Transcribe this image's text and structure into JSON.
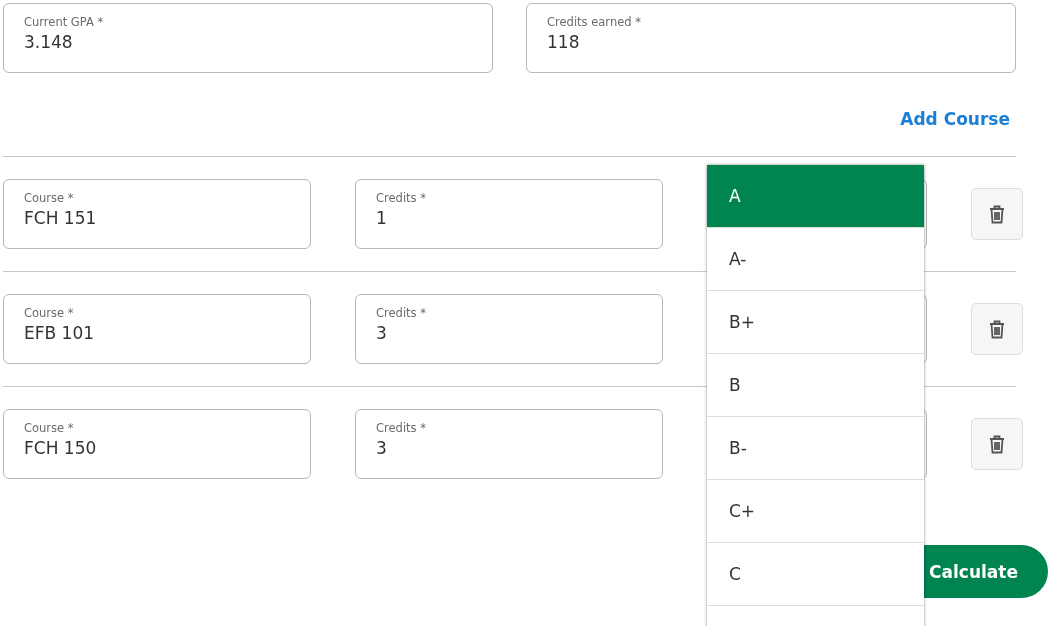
{
  "summary_fields": [
    {
      "label": "Current GPA *",
      "value": "3.148"
    },
    {
      "label": "Credits earned *",
      "value": "118"
    }
  ],
  "add_course": "Add Course",
  "courses": [
    {
      "course_label": "Course *",
      "course": "FCH 151",
      "credits_label": "Credits *",
      "credits": "1"
    },
    {
      "course_label": "Course *",
      "course": "EFB 101",
      "credits_label": "Credits *",
      "credits": "3"
    },
    {
      "course_label": "Course *",
      "course": "FCH 150",
      "credits_label": "Credits *",
      "credits": "3"
    }
  ],
  "grade_menu": [
    {
      "label": "A",
      "selected": true
    },
    {
      "label": "A-",
      "selected": false
    },
    {
      "label": "B+",
      "selected": false
    },
    {
      "label": "B",
      "selected": false
    },
    {
      "label": "B-",
      "selected": false
    },
    {
      "label": "C+",
      "selected": false
    },
    {
      "label": "C",
      "selected": false
    }
  ],
  "calculate": "Calculate"
}
